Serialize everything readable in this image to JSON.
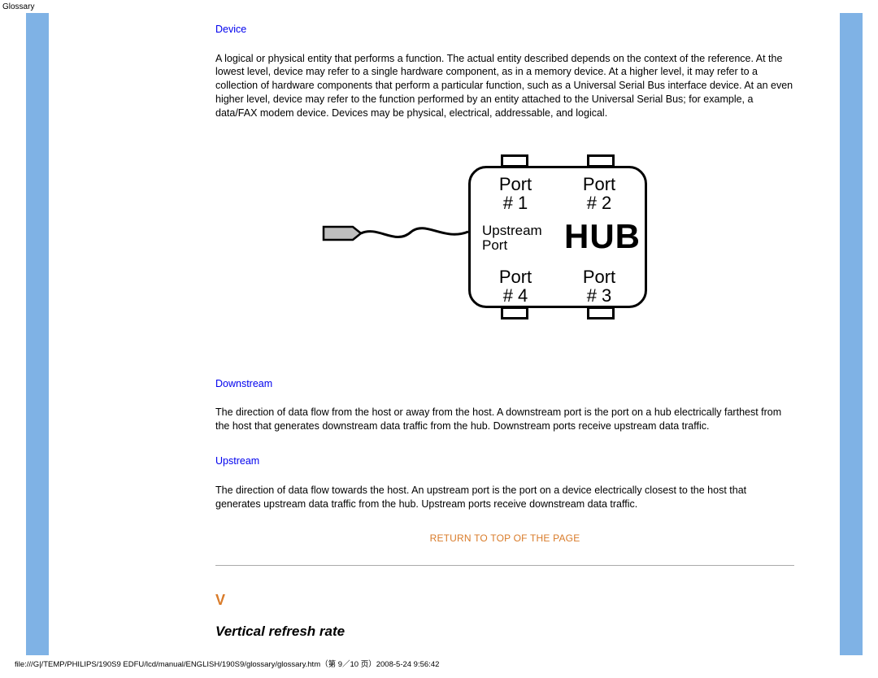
{
  "page": {
    "header_label": "Glossary",
    "footer_path": "file:///G|/TEMP/PHILIPS/190S9 EDFU/lcd/manual/ENGLISH/190S9/glossary/glossary.htm（第 9／10 页）2008-5-24 9:56:42"
  },
  "terms": {
    "device": {
      "label": "Device",
      "definition": "A logical or physical entity that performs a function. The actual entity described depends on the context of the reference. At the lowest level, device may refer to a single hardware component, as in a memory device. At a higher level, it may refer to a collection of hardware components that perform a particular function, such as a Universal Serial Bus interface device. At an even higher level, device may refer to the function performed by an entity attached to the Universal Serial Bus; for example, a data/FAX modem device. Devices may be physical, electrical, addressable, and logical."
    },
    "downstream": {
      "label": "Downstream",
      "definition": "The direction of data flow from the host or away from the host. A downstream port is the port on a hub electrically farthest from the host that generates downstream data traffic from the hub. Downstream ports receive upstream data traffic."
    },
    "upstream": {
      "label": "Upstream",
      "definition": "The direction of data flow towards the host. An upstream port is the port on a device electrically closest to the host that generates upstream data traffic from the hub. Upstream ports receive downstream data traffic."
    }
  },
  "diagram": {
    "port1": "Port\n# 1",
    "port2": "Port\n# 2",
    "port3": "Port\n# 3",
    "port4": "Port\n# 4",
    "upstream": "Upstream\nPort",
    "hub": "HUB"
  },
  "nav": {
    "return_top": "RETURN TO TOP OF THE PAGE"
  },
  "section": {
    "letter": "V",
    "title": "Vertical refresh rate"
  }
}
